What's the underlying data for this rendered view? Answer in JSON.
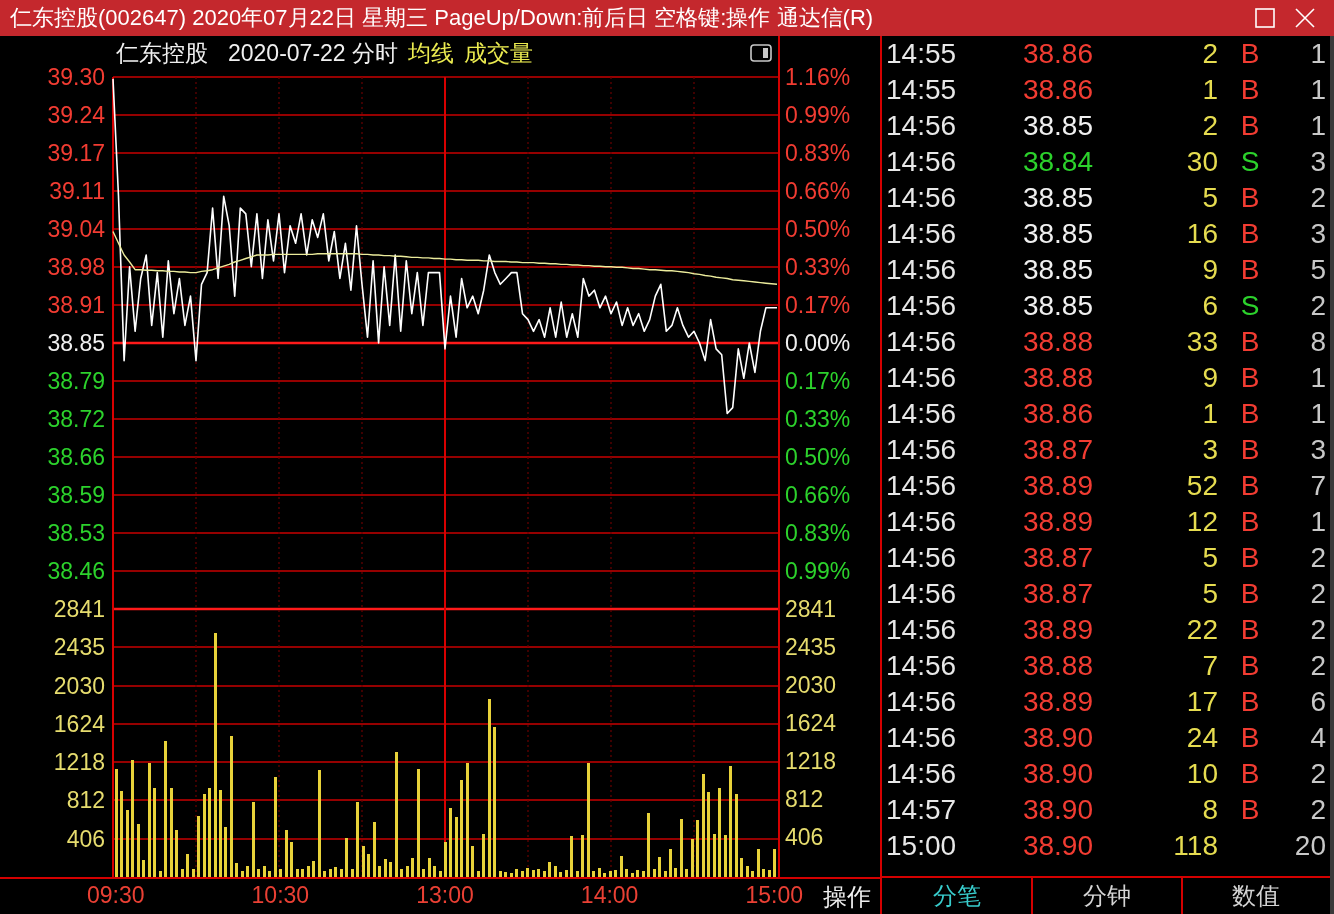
{
  "window": {
    "title": "仁东控股(002647) 2020年07月22日 星期三 PageUp/Down:前后日 空格键:操作 通达信(R)"
  },
  "chart_header": {
    "stock_name": "仁东控股",
    "period": "2020-07-22 分时"
  },
  "price_chart": {
    "chart_data": {
      "type": "line",
      "grid": true,
      "ylim": [
        38.4292,
        39.3033
      ],
      "yticks": [
        {
          "value": 39.3033,
          "label": "39.30"
        },
        {
          "value": 39.2385,
          "label": "39.24"
        },
        {
          "value": 39.1738,
          "label": "39.17"
        },
        {
          "value": 39.109,
          "label": "39.11"
        },
        {
          "value": 39.0443,
          "label": "39.04"
        },
        {
          "value": 38.9795,
          "label": "38.98"
        },
        {
          "value": 38.9148,
          "label": "38.91"
        },
        {
          "value": 38.85,
          "label": "38.85"
        },
        {
          "value": 38.7853,
          "label": "38.79"
        },
        {
          "value": 38.7205,
          "label": "38.72"
        },
        {
          "value": 38.6558,
          "label": "38.66"
        },
        {
          "value": 38.591,
          "label": "38.59"
        },
        {
          "value": 38.5263,
          "label": "38.53"
        },
        {
          "value": 38.4615,
          "label": "38.46"
        }
      ],
      "ref_lines": [
        {
          "axis": "y",
          "value": 38.85
        }
      ],
      "series": [
        {
          "color": "#ffffff",
          "values": [
            39.3,
            39.1,
            38.82,
            38.98,
            38.87,
            38.96,
            39.0,
            38.88,
            38.97,
            38.86,
            38.99,
            38.9,
            38.96,
            38.88,
            38.93,
            38.82,
            38.95,
            38.97,
            39.08,
            38.96,
            39.1,
            39.05,
            38.93,
            39.08,
            39.07,
            38.98,
            39.07,
            38.96,
            39.06,
            38.99,
            39.07,
            38.97,
            39.05,
            39.02,
            39.07,
            39.0,
            39.06,
            39.03,
            39.07,
            38.99,
            39.04,
            38.96,
            39.02,
            38.94,
            39.05,
            38.95,
            38.86,
            38.99,
            38.85,
            38.98,
            38.88,
            39.0,
            38.87,
            38.99,
            38.9,
            38.97,
            38.88,
            38.97,
            38.97,
            38.97,
            38.84,
            38.93,
            38.86,
            38.96,
            38.91,
            38.93,
            38.9,
            38.94,
            39.0,
            38.97,
            38.95,
            38.96,
            38.97,
            38.97,
            38.9,
            38.89,
            38.87,
            38.89,
            38.86,
            38.91,
            38.86,
            38.92,
            38.86,
            38.9,
            38.86,
            38.96,
            38.93,
            38.94,
            38.91,
            38.93,
            38.9,
            38.92,
            38.88,
            38.91,
            38.88,
            38.9,
            38.87,
            38.89,
            38.93,
            38.95,
            38.87,
            38.88,
            38.91,
            38.88,
            38.86,
            38.87,
            38.85,
            38.82,
            38.89,
            38.84,
            38.83,
            38.73,
            38.74,
            38.84,
            38.79,
            38.85,
            38.8,
            38.87,
            38.91,
            38.91,
            38.91
          ]
        },
        {
          "name": "均线",
          "color": "#ecec9c",
          "values": [
            39.04,
            39.02,
            39.0,
            38.988,
            38.975,
            38.975,
            38.974,
            38.974,
            38.973,
            38.973,
            38.972,
            38.972,
            38.971,
            38.971,
            38.97,
            38.97,
            38.972,
            38.973,
            38.975,
            38.978,
            38.981,
            38.984,
            38.988,
            38.991,
            38.994,
            38.997,
            39.0,
            39.0,
            39.0,
            39.001,
            39.001,
            39.001,
            39.001,
            39.001,
            39.001,
            39.001,
            39.001,
            39.002,
            39.002,
            39.002,
            39.002,
            39.002,
            39.002,
            39.002,
            39.002,
            39.001,
            39.001,
            39.0,
            39.0,
            38.999,
            38.999,
            38.998,
            38.998,
            38.997,
            38.996,
            38.996,
            38.995,
            38.995,
            38.994,
            38.994,
            38.993,
            38.993,
            38.992,
            38.992,
            38.991,
            38.991,
            38.991,
            38.99,
            38.99,
            38.989,
            38.989,
            38.989,
            38.988,
            38.988,
            38.987,
            38.987,
            38.987,
            38.986,
            38.986,
            38.985,
            38.985,
            38.984,
            38.984,
            38.983,
            38.983,
            38.982,
            38.982,
            38.981,
            38.981,
            38.98,
            38.98,
            38.979,
            38.979,
            38.978,
            38.977,
            38.977,
            38.976,
            38.975,
            38.975,
            38.974,
            38.973,
            38.973,
            38.972,
            38.971,
            38.97,
            38.968,
            38.967,
            38.965,
            38.964,
            38.962,
            38.961,
            38.96,
            38.958,
            38.957,
            38.956,
            38.955,
            38.954,
            38.953,
            38.952,
            38.951,
            38.95
          ]
        }
      ]
    },
    "percent_labels": [
      {
        "label": "1.16%",
        "color": "#f23c32"
      },
      {
        "label": "0.99%",
        "color": "#f23c32"
      },
      {
        "label": "0.83%",
        "color": "#f23c32"
      },
      {
        "label": "0.66%",
        "color": "#f23c32"
      },
      {
        "label": "0.50%",
        "color": "#f23c32"
      },
      {
        "label": "0.33%",
        "color": "#f23c32"
      },
      {
        "label": "0.17%",
        "color": "#f23c32"
      },
      {
        "label": "0.00%",
        "color": "#f0f0f0"
      },
      {
        "label": "0.17%",
        "color": "#2cd22c"
      },
      {
        "label": "0.33%",
        "color": "#2cd22c"
      },
      {
        "label": "0.50%",
        "color": "#2cd22c"
      },
      {
        "label": "0.66%",
        "color": "#2cd22c"
      },
      {
        "label": "0.83%",
        "color": "#2cd22c"
      },
      {
        "label": "0.99%",
        "color": "#2cd22c"
      }
    ]
  },
  "volume_chart": {
    "chart_data": {
      "type": "bar",
      "grid": true,
      "categories": [
        "09:30",
        null,
        null,
        null,
        null,
        null,
        null,
        null,
        null,
        null,
        null,
        null,
        null,
        null,
        null,
        null,
        null,
        null,
        null,
        null,
        null,
        null,
        null,
        null,
        null,
        null,
        null,
        null,
        null,
        null,
        "10:30",
        null,
        null,
        null,
        null,
        null,
        null,
        null,
        null,
        null,
        null,
        null,
        null,
        null,
        null,
        null,
        null,
        null,
        null,
        null,
        null,
        null,
        null,
        null,
        null,
        null,
        null,
        null,
        null,
        null,
        "13:00",
        null,
        null,
        null,
        null,
        null,
        null,
        null,
        null,
        null,
        null,
        null,
        null,
        null,
        null,
        null,
        null,
        null,
        null,
        null,
        null,
        null,
        null,
        null,
        null,
        null,
        null,
        null,
        null,
        null,
        "14:00",
        null,
        null,
        null,
        null,
        null,
        null,
        null,
        null,
        null,
        null,
        null,
        null,
        null,
        null,
        null,
        null,
        null,
        null,
        null,
        null,
        null,
        null,
        null,
        null,
        null,
        null,
        null,
        null,
        null,
        "15:00"
      ],
      "ylim": [
        0,
        2841
      ],
      "yticks": [
        2841,
        2435,
        2030,
        1624,
        1218,
        812,
        406
      ],
      "series": [
        {
          "name": "成交量",
          "color": "#e8d23a",
          "values": [
            1150,
            910,
            710,
            1240,
            560,
            180,
            1210,
            940,
            60,
            1440,
            940,
            500,
            80,
            240,
            90,
            650,
            880,
            940,
            2590,
            920,
            530,
            1500,
            150,
            60,
            120,
            800,
            80,
            120,
            60,
            1060,
            90,
            500,
            370,
            80,
            90,
            120,
            170,
            1130,
            60,
            90,
            110,
            80,
            410,
            90,
            800,
            330,
            240,
            580,
            120,
            190,
            160,
            1320,
            80,
            120,
            200,
            1150,
            90,
            200,
            120,
            60,
            370,
            730,
            640,
            1030,
            1210,
            330,
            60,
            460,
            1890,
            1590,
            60,
            50,
            40,
            80,
            60,
            100,
            70,
            90,
            60,
            160,
            120,
            50,
            70,
            430,
            60,
            450,
            1210,
            60,
            100,
            40,
            60,
            70,
            220,
            80,
            40,
            70,
            60,
            680,
            90,
            210,
            60,
            300,
            100,
            620,
            90,
            400,
            600,
            1090,
            900,
            460,
            940,
            450,
            1180,
            880,
            200,
            120,
            60,
            300,
            80,
            70,
            300
          ]
        }
      ]
    },
    "right_axis_labels": [
      "2841",
      "2435",
      "2030",
      "1624",
      "1218",
      "812",
      "406"
    ]
  },
  "operate_button": "操作",
  "trades": [
    {
      "time": "14:55",
      "price": "38.86",
      "color": "#f23c32",
      "volume": "2",
      "side": {
        "text": "B",
        "color": "#f23c32"
      },
      "count": "1"
    },
    {
      "time": "14:55",
      "price": "38.86",
      "color": "#f23c32",
      "volume": "1",
      "side": {
        "text": "B",
        "color": "#f23c32"
      },
      "count": "1"
    },
    {
      "time": "14:56",
      "price": "38.85",
      "color": "#f0f0f0",
      "volume": "2",
      "side": {
        "text": "B",
        "color": "#f23c32"
      },
      "count": "1"
    },
    {
      "time": "14:56",
      "price": "38.84",
      "color": "#2cd22c",
      "volume": "30",
      "side": {
        "text": "S",
        "color": "#2cd22c"
      },
      "count": "3"
    },
    {
      "time": "14:56",
      "price": "38.85",
      "color": "#f0f0f0",
      "volume": "5",
      "side": {
        "text": "B",
        "color": "#f23c32"
      },
      "count": "2"
    },
    {
      "time": "14:56",
      "price": "38.85",
      "color": "#f0f0f0",
      "volume": "16",
      "side": {
        "text": "B",
        "color": "#f23c32"
      },
      "count": "3"
    },
    {
      "time": "14:56",
      "price": "38.85",
      "color": "#f0f0f0",
      "volume": "9",
      "side": {
        "text": "B",
        "color": "#f23c32"
      },
      "count": "5"
    },
    {
      "time": "14:56",
      "price": "38.85",
      "color": "#f0f0f0",
      "volume": "6",
      "side": {
        "text": "S",
        "color": "#2cd22c"
      },
      "count": "2"
    },
    {
      "time": "14:56",
      "price": "38.88",
      "color": "#f23c32",
      "volume": "33",
      "side": {
        "text": "B",
        "color": "#f23c32"
      },
      "count": "8"
    },
    {
      "time": "14:56",
      "price": "38.88",
      "color": "#f23c32",
      "volume": "9",
      "side": {
        "text": "B",
        "color": "#f23c32"
      },
      "count": "1"
    },
    {
      "time": "14:56",
      "price": "38.86",
      "color": "#f23c32",
      "volume": "1",
      "side": {
        "text": "B",
        "color": "#f23c32"
      },
      "count": "1"
    },
    {
      "time": "14:56",
      "price": "38.87",
      "color": "#f23c32",
      "volume": "3",
      "side": {
        "text": "B",
        "color": "#f23c32"
      },
      "count": "3"
    },
    {
      "time": "14:56",
      "price": "38.89",
      "color": "#f23c32",
      "volume": "52",
      "side": {
        "text": "B",
        "color": "#f23c32"
      },
      "count": "7"
    },
    {
      "time": "14:56",
      "price": "38.89",
      "color": "#f23c32",
      "volume": "12",
      "side": {
        "text": "B",
        "color": "#f23c32"
      },
      "count": "1"
    },
    {
      "time": "14:56",
      "price": "38.87",
      "color": "#f23c32",
      "volume": "5",
      "side": {
        "text": "B",
        "color": "#f23c32"
      },
      "count": "2"
    },
    {
      "time": "14:56",
      "price": "38.87",
      "color": "#f23c32",
      "volume": "5",
      "side": {
        "text": "B",
        "color": "#f23c32"
      },
      "count": "2"
    },
    {
      "time": "14:56",
      "price": "38.89",
      "color": "#f23c32",
      "volume": "22",
      "side": {
        "text": "B",
        "color": "#f23c32"
      },
      "count": "2"
    },
    {
      "time": "14:56",
      "price": "38.88",
      "color": "#f23c32",
      "volume": "7",
      "side": {
        "text": "B",
        "color": "#f23c32"
      },
      "count": "2"
    },
    {
      "time": "14:56",
      "price": "38.89",
      "color": "#f23c32",
      "volume": "17",
      "side": {
        "text": "B",
        "color": "#f23c32"
      },
      "count": "6"
    },
    {
      "time": "14:56",
      "price": "38.90",
      "color": "#f23c32",
      "volume": "24",
      "side": {
        "text": "B",
        "color": "#f23c32"
      },
      "count": "4"
    },
    {
      "time": "14:56",
      "price": "38.90",
      "color": "#f23c32",
      "volume": "10",
      "side": {
        "text": "B",
        "color": "#f23c32"
      },
      "count": "2"
    },
    {
      "time": "14:57",
      "price": "38.90",
      "color": "#f23c32",
      "volume": "8",
      "side": {
        "text": "B",
        "color": "#f23c32"
      },
      "count": "2"
    },
    {
      "time": "15:00",
      "price": "38.90",
      "color": "#f23c32",
      "volume": "118",
      "count": "20"
    }
  ],
  "trade_tabs": [
    {
      "label": "分笔",
      "selected": true
    },
    {
      "label": "分钟",
      "selected": false
    },
    {
      "label": "数值",
      "selected": false
    }
  ]
}
